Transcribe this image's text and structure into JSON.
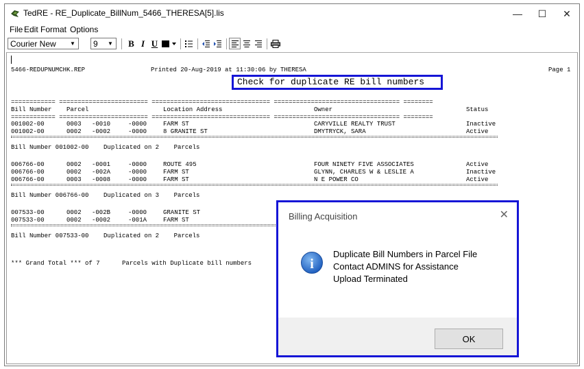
{
  "window": {
    "title": "TedRE - RE_Duplicate_BillNum_5466_THERESA[5].lis",
    "minimize": "—",
    "maximize": "☐",
    "close": "✕"
  },
  "menu": [
    "File",
    "Edit",
    "Format",
    "Options"
  ],
  "toolbar": {
    "font": "Courier New",
    "size": "9",
    "bold": "B",
    "italic": "I",
    "underline": "U"
  },
  "report": {
    "file": "5466-REDUPNUMCHK.REP",
    "printed": "Printed 20-Aug-2019 at 11:30:06 by THERESA",
    "page": "Page 1",
    "heading": "Check for duplicate RE bill numbers",
    "dash_line": "============ ======================== ================================ ================================== ========",
    "columns": {
      "bill": "Bill Number",
      "parcel": "Parcel",
      "location": "Location Address",
      "owner": "Owner",
      "status": "Status"
    },
    "groups": [
      {
        "rows": [
          {
            "bill": "001002-00",
            "p1": "0003",
            "p2": "-0010",
            "p3": "-0000",
            "loc": "FARM ST",
            "owner": "CARYVILLE REALTY TRUST",
            "status": "Inactive"
          },
          {
            "bill": "001002-00",
            "p1": "0002",
            "p2": "-0002",
            "p3": "-0000",
            "loc": "8 GRANITE ST",
            "owner": "DMYTRYCK, SARA",
            "status": "Active"
          }
        ],
        "summary": "Bill Number 001002-00    Duplicated on 2    Parcels"
      },
      {
        "rows": [
          {
            "bill": "006766-00",
            "p1": "0002",
            "p2": "-0001",
            "p3": "-0000",
            "loc": "ROUTE 495",
            "owner": "FOUR NINETY FIVE ASSOCIATES",
            "status": "Active"
          },
          {
            "bill": "006766-00",
            "p1": "0002",
            "p2": "-002A",
            "p3": "-0000",
            "loc": "FARM ST",
            "owner": "GLYNN, CHARLES W & LESLIE A",
            "status": "Inactive"
          },
          {
            "bill": "006766-00",
            "p1": "0003",
            "p2": "-0008",
            "p3": "-0000",
            "loc": "FARM ST",
            "owner": "N E POWER CO",
            "status": "Active"
          }
        ],
        "summary": "Bill Number 006766-00    Duplicated on 3    Parcels"
      },
      {
        "rows": [
          {
            "bill": "007533-00",
            "p1": "0002",
            "p2": "-002B",
            "p3": "-0000",
            "loc": "GRANITE ST",
            "owner": "",
            "status": ""
          },
          {
            "bill": "007533-00",
            "p1": "0002",
            "p2": "-0002",
            "p3": "-001A",
            "loc": "FARM ST",
            "owner": "",
            "status": ""
          }
        ],
        "summary": "Bill Number 007533-00    Duplicated on 2    Parcels"
      }
    ],
    "grand_total": "*** Grand Total *** of 7      Parcels with Duplicate bill numbers"
  },
  "dialog": {
    "title": "Billing Acquisition",
    "close": "✕",
    "line1": "Duplicate Bill Numbers in Parcel File",
    "line2": "Contact ADMINS for Assistance",
    "line3": "Upload Terminated",
    "ok": "OK",
    "info_glyph": "i"
  },
  "colors": {
    "highlight": "#1515d6",
    "info_blue": "#1f6fd1"
  }
}
